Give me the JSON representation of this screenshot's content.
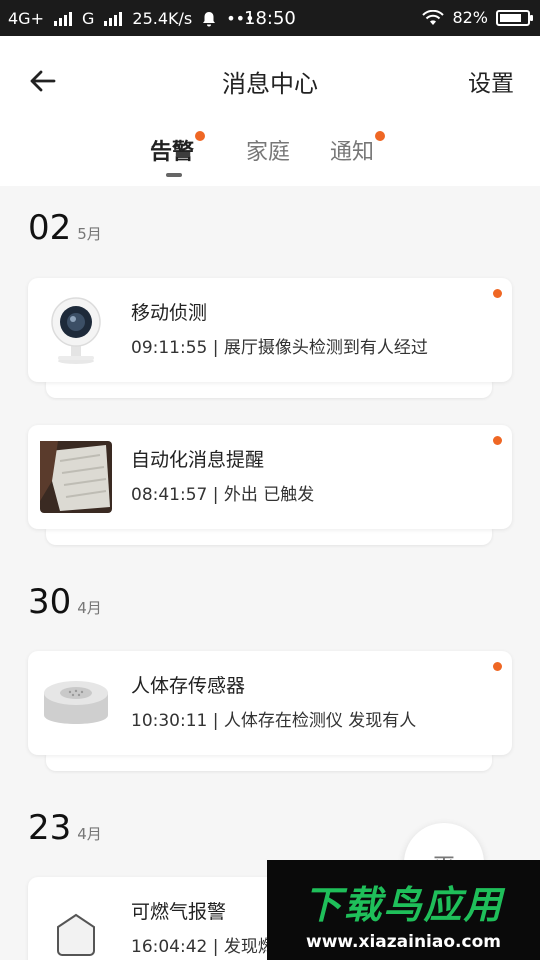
{
  "status_bar": {
    "network1": "4G+",
    "network2": "G",
    "speed": "25.4K/s",
    "dots": "•••",
    "time": "18:50",
    "battery": "82%",
    "battery_level": 0.82
  },
  "header": {
    "title": "消息中心",
    "settings_label": "设置"
  },
  "tabs": [
    {
      "label": "告警",
      "active": true,
      "has_dot": true
    },
    {
      "label": "家庭",
      "active": false,
      "has_dot": false
    },
    {
      "label": "通知",
      "active": false,
      "has_dot": true
    }
  ],
  "sections": [
    {
      "day": "02",
      "month": "5月",
      "items": [
        {
          "icon": "camera-icon",
          "title": "移动侦测",
          "desc": "09:11:55 | 展厅摄像头检测到有人经过"
        }
      ]
    },
    {
      "day": "",
      "month": "",
      "items": [
        {
          "icon": "automation-photo",
          "title": "自动化消息提醒",
          "desc": "08:41:57 | 外出 已触发"
        }
      ]
    },
    {
      "day": "30",
      "month": "4月",
      "items": [
        {
          "icon": "presence-sensor-icon",
          "title": "人体存传感器",
          "desc": "10:30:11 | 人体存在检测仪 发现有人"
        }
      ]
    },
    {
      "day": "23",
      "month": "4月",
      "items": [
        {
          "icon": "gas-alarm-icon",
          "title": "可燃气报警",
          "desc": "16:04:42 | 发现燃"
        }
      ]
    }
  ],
  "fab": {
    "glyph": "平"
  },
  "watermark": {
    "logo": "下载鸟应用",
    "url": "www.xiazainiao.com"
  },
  "colors": {
    "accent": "#ef6724",
    "status_bar": "#1b1b1b",
    "background": "#f6f6f6",
    "watermark_green": "#1fbf5a"
  }
}
